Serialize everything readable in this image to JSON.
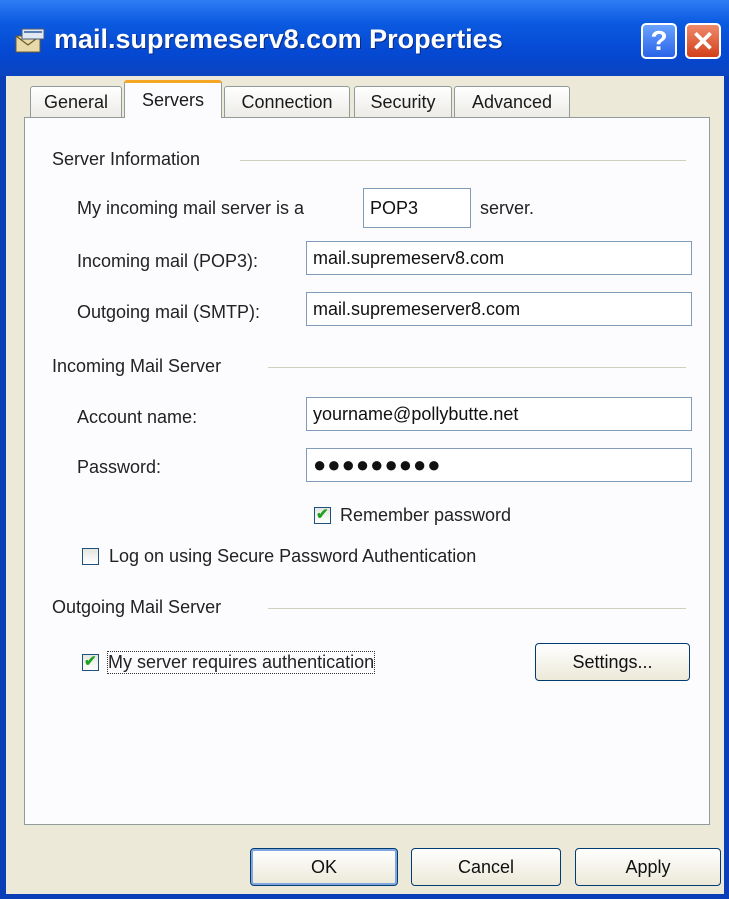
{
  "window": {
    "title": "mail.supremeserv8.com Properties",
    "help_glyph": "?",
    "close_glyph": "✕"
  },
  "tabs": [
    {
      "label": "General"
    },
    {
      "label": "Servers",
      "active": true
    },
    {
      "label": "Connection"
    },
    {
      "label": "Security"
    },
    {
      "label": "Advanced"
    }
  ],
  "server_info": {
    "heading": "Server Information",
    "incoming_type_prefix": "My incoming mail server is a",
    "incoming_type_value": "POP3",
    "incoming_type_suffix": "server.",
    "incoming_label": "Incoming mail (POP3):",
    "incoming_value": "mail.supremeserv8.com",
    "outgoing_label": "Outgoing mail (SMTP):",
    "outgoing_value": "mail.supremeserver8.com"
  },
  "incoming_server": {
    "heading": "Incoming Mail Server",
    "account_label": "Account name:",
    "account_value": "yourname@pollybutte.net",
    "password_label": "Password:",
    "password_value": "●●●●●●●●●",
    "remember_label": "Remember password",
    "remember_checked": true,
    "spa_label": "Log on using Secure Password Authentication",
    "spa_checked": false
  },
  "outgoing_server": {
    "heading": "Outgoing Mail Server",
    "auth_label": "My server requires authentication",
    "auth_checked": true,
    "settings_label": "Settings..."
  },
  "buttons": {
    "ok": "OK",
    "cancel": "Cancel",
    "apply": "Apply"
  },
  "colors": {
    "titlebar": "#0548d2",
    "tab_accent": "#f5a623",
    "check": "#21a121"
  }
}
